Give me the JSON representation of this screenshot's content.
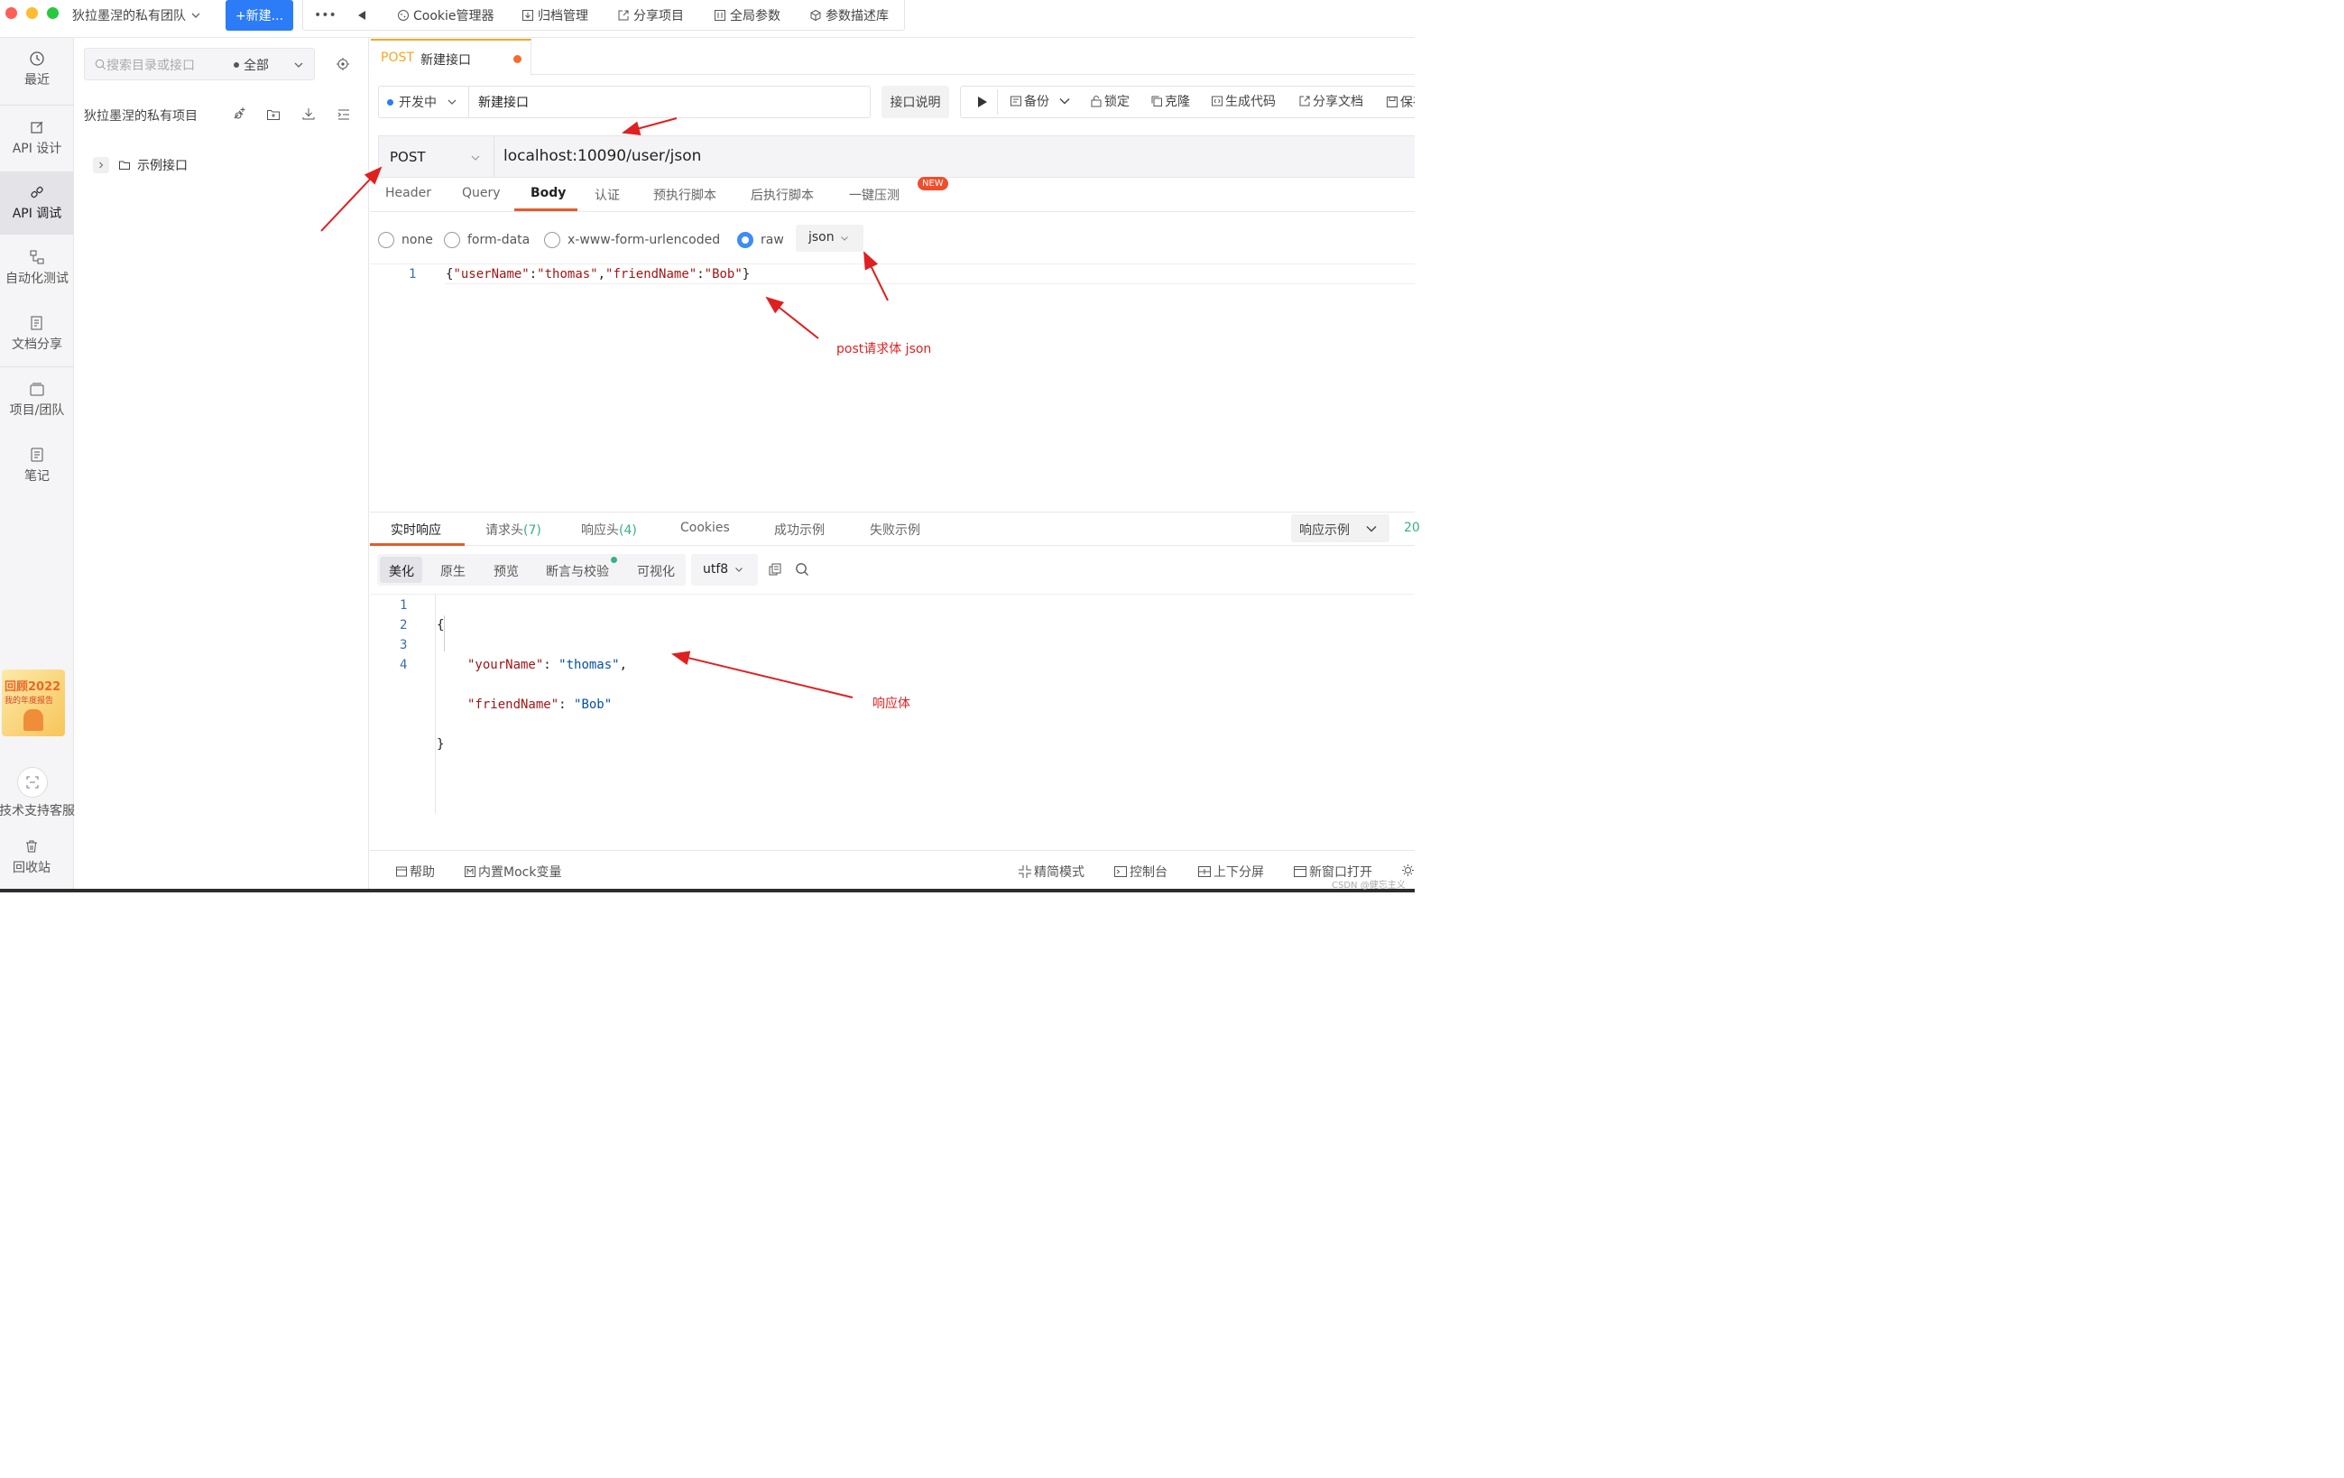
{
  "topbar": {
    "team": "狄拉墨涅的私有团队",
    "new_button": "+新建...",
    "more": "•••",
    "items": [
      "Cookie管理器",
      "归档管理",
      "分享项目",
      "全局参数",
      "参数描述库"
    ]
  },
  "rail": {
    "items": [
      "最近",
      "API 设计",
      "API 调试",
      "自动化测试",
      "文档分享",
      "项目/团队",
      "笔记"
    ],
    "promo_line1": "回顾2022",
    "promo_line2": "我的年度报告",
    "support": "技术支持客服",
    "trash": "回收站"
  },
  "tree": {
    "search_placeholder": "搜索目录或接口",
    "filter": "全部",
    "project": "狄拉墨涅的私有项目",
    "folder": "示例接口"
  },
  "tab": {
    "method": "POST",
    "title": "新建接口"
  },
  "request": {
    "status": "开发中",
    "name": "新建接口",
    "doc_button": "接口说明",
    "actions": [
      "备份",
      "锁定",
      "克隆",
      "生成代码",
      "分享文档",
      "保存"
    ],
    "method": "POST",
    "url": "localhost:10090/user/json"
  },
  "req_tabs": [
    "Header",
    "Query",
    "Body",
    "认证",
    "预执行脚本",
    "后执行脚本",
    "一键压测"
  ],
  "new_badge": "NEW",
  "body_types": [
    "none",
    "form-data",
    "x-www-form-urlencoded",
    "raw"
  ],
  "body_format": "json",
  "request_body": {
    "line_no": "1",
    "tokens": [
      "{",
      "\"userName\"",
      ":",
      "\"thomas\"",
      ",",
      "\"friendName\"",
      ":",
      "\"Bob\"",
      "}"
    ]
  },
  "annotations": {
    "body": "post请求体 json",
    "response": "响应体"
  },
  "resp_tabs": {
    "items": [
      "实时响应",
      "请求头",
      "响应头",
      "Cookies",
      "成功示例",
      "失败示例"
    ],
    "req_header_count": "(7)",
    "resp_header_count": "(4)"
  },
  "resp_example": "响应示例",
  "status_peek": "20",
  "resp_view": {
    "items": [
      "美化",
      "原生",
      "预览",
      "断言与校验",
      "可视化"
    ],
    "encoding": "utf8"
  },
  "response_body": {
    "line_nos": [
      "1",
      "2",
      "3",
      "4"
    ],
    "open": "{",
    "close": "}",
    "k1": "\"yourName\"",
    "v1": "\"thomas\"",
    "k2": "\"friendName\"",
    "v2": "\"Bob\""
  },
  "footer": {
    "help": "帮助",
    "mock": "内置Mock变量",
    "simple": "精简模式",
    "console": "控制台",
    "split": "上下分屏",
    "new_window": "新窗口打开"
  },
  "watermark": "CSDN @健忘主义",
  "colors": {
    "accent": "#2b7cf6",
    "post": "#f5a623",
    "annotation": "#e02020",
    "green": "#36b37e"
  }
}
